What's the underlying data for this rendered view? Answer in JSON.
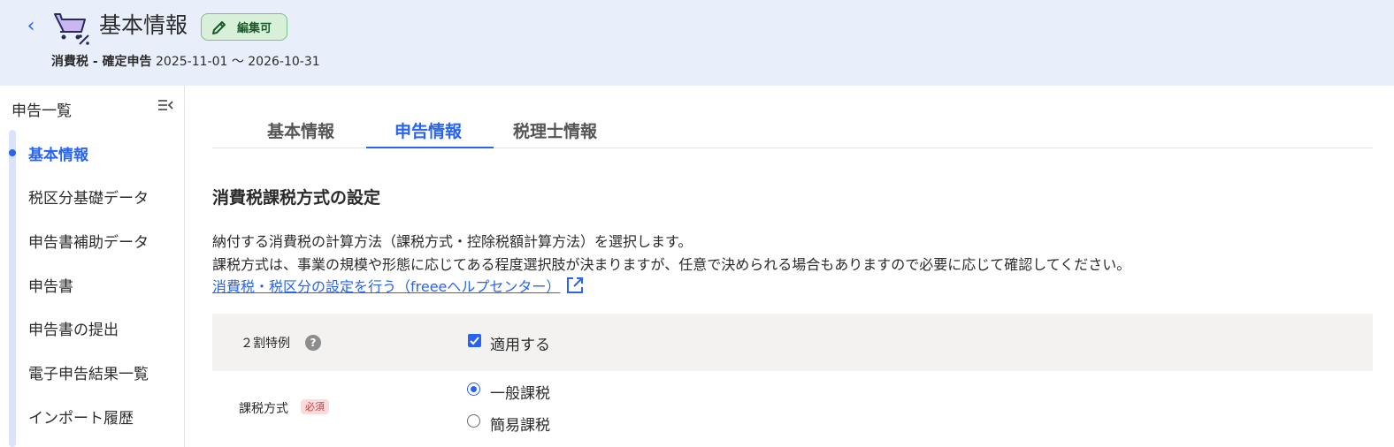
{
  "header": {
    "back_icon": "chevron-left-icon",
    "app_icon": "cart-percent-icon",
    "title": "基本情報",
    "edit_badge": "編集可",
    "tax_kind": "消費税 - 確定申告",
    "period": "2025-11-01 〜 2026-10-31"
  },
  "sidebar": {
    "heading": "申告一覧",
    "collapse_icon": "collapse-sidebar-icon",
    "items": [
      {
        "label": "基本情報",
        "active": true
      },
      {
        "label": "税区分基礎データ",
        "active": false
      },
      {
        "label": "申告書補助データ",
        "active": false
      },
      {
        "label": "申告書",
        "active": false
      },
      {
        "label": "申告書の提出",
        "active": false
      },
      {
        "label": "電子申告結果一覧",
        "active": false
      },
      {
        "label": "インポート履歴",
        "active": false
      }
    ]
  },
  "tabs": [
    {
      "label": "基本情報",
      "active": false
    },
    {
      "label": "申告情報",
      "active": true
    },
    {
      "label": "税理士情報",
      "active": false
    }
  ],
  "section": {
    "title": "消費税課税方式の設定",
    "desc1": "納付する消費税の計算方法（課税方式・控除税額計算方法）を選択します。",
    "desc2": "課税方式は、事業の規模や形態に応じてある程度選択肢が決まりますが、任意で決められる場合もありますので必要に応じて確認してください。",
    "help_link": "消費税・税区分の設定を行う（freeeヘルプセンター）"
  },
  "fields": {
    "special": {
      "label": "２割特例",
      "help_icon": "?",
      "checkbox_label": "適用する",
      "checked": true
    },
    "method": {
      "label": "課税方式",
      "required": "必須",
      "options": [
        {
          "label": "一般課税",
          "selected": true
        },
        {
          "label": "簡易課税",
          "selected": false
        }
      ]
    }
  },
  "colors": {
    "accent": "#2864f0",
    "header_bg": "#e8effb",
    "badge_bg": "#d8f0da",
    "row_bg": "#f3f2f1"
  }
}
